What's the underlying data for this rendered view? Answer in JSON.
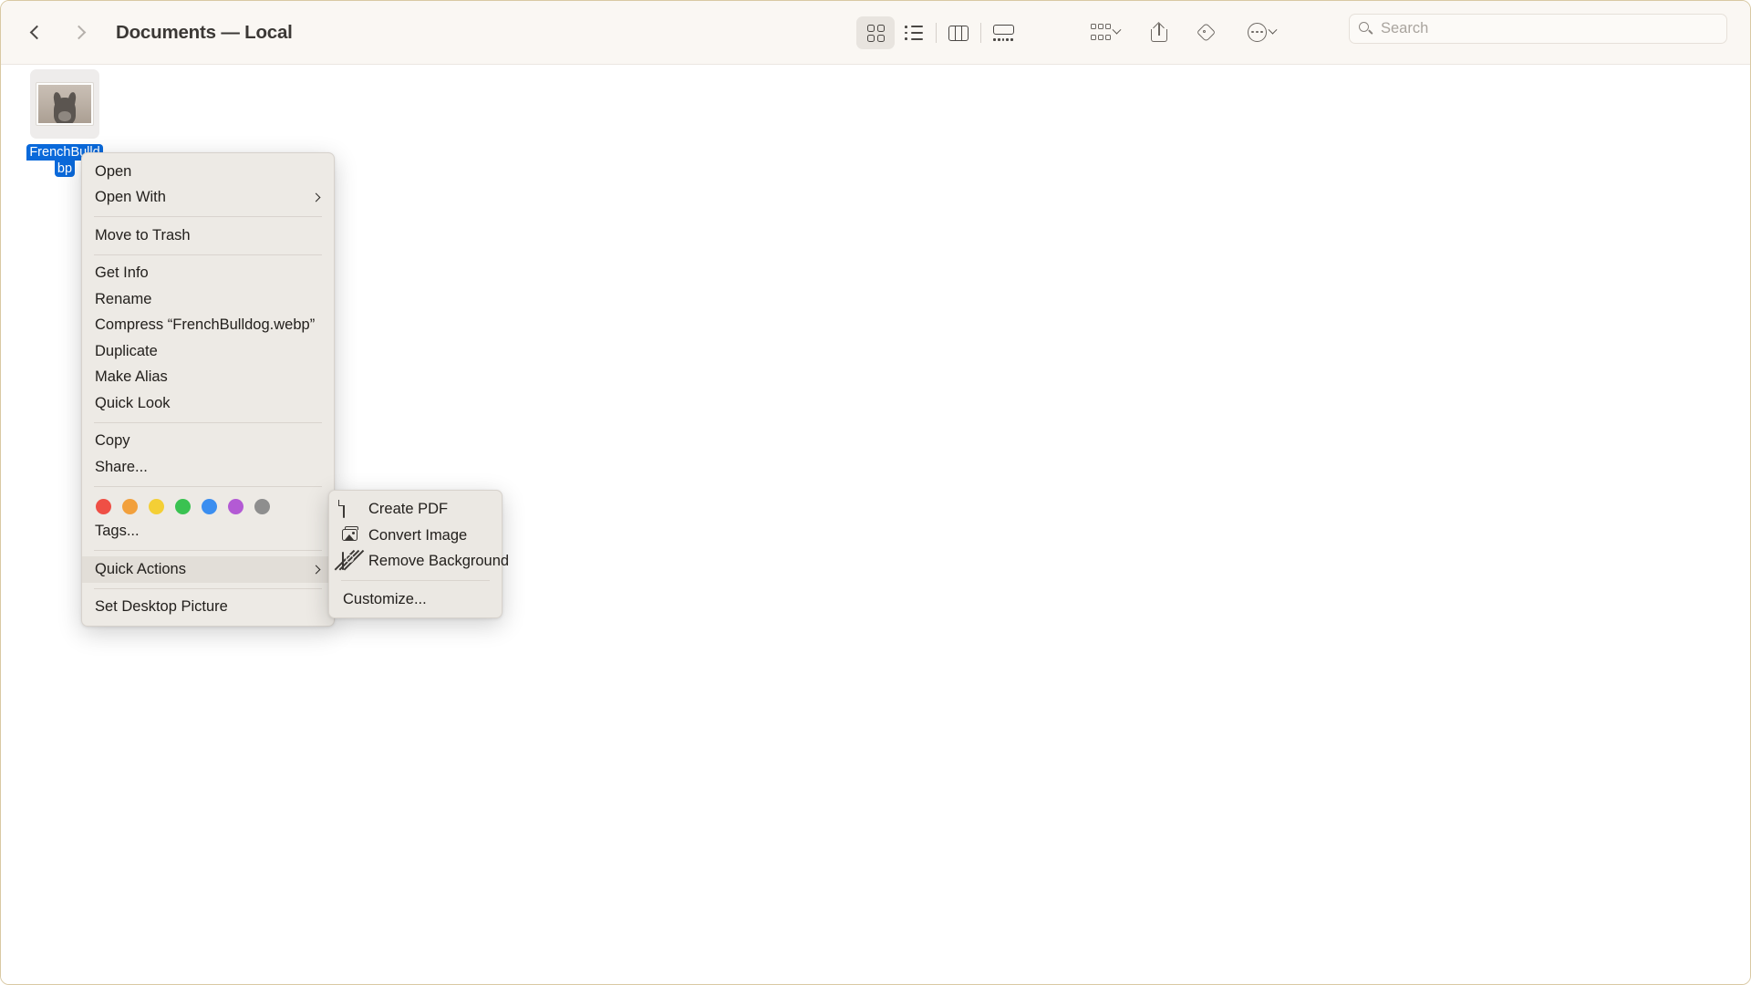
{
  "window": {
    "title": "Documents — Local"
  },
  "nav": {
    "back_label": "Back",
    "forward_label": "Forward"
  },
  "toolbar": {
    "view_modes": [
      {
        "name": "icon-view",
        "label": "Icon View",
        "active": true
      },
      {
        "name": "list-view",
        "label": "List View",
        "active": false
      },
      {
        "name": "column-view",
        "label": "Column View",
        "active": false
      },
      {
        "name": "gallery-view",
        "label": "Gallery View",
        "active": false
      }
    ],
    "actions": [
      {
        "name": "group-by",
        "label": "Group By"
      },
      {
        "name": "share",
        "label": "Share"
      },
      {
        "name": "tags",
        "label": "Tags"
      },
      {
        "name": "more",
        "label": "More"
      }
    ]
  },
  "search": {
    "placeholder": "Search",
    "value": ""
  },
  "file": {
    "name_line1": "FrenchBulld",
    "name_line2": "bp",
    "full_name": "FrenchBulldog.webp",
    "selected": true,
    "selection_color": "#0a69da"
  },
  "context_menu": {
    "groups": [
      [
        {
          "label": "Open",
          "name": "menu-open",
          "submenu": false
        },
        {
          "label": "Open With",
          "name": "menu-open-with",
          "submenu": true
        }
      ],
      [
        {
          "label": "Move to Trash",
          "name": "menu-move-to-trash",
          "submenu": false
        }
      ],
      [
        {
          "label": "Get Info",
          "name": "menu-get-info",
          "submenu": false
        },
        {
          "label": "Rename",
          "name": "menu-rename",
          "submenu": false
        },
        {
          "label": "Compress “FrenchBulldog.webp”",
          "name": "menu-compress",
          "submenu": false
        },
        {
          "label": "Duplicate",
          "name": "menu-duplicate",
          "submenu": false
        },
        {
          "label": "Make Alias",
          "name": "menu-make-alias",
          "submenu": false
        },
        {
          "label": "Quick Look",
          "name": "menu-quick-look",
          "submenu": false
        }
      ],
      [
        {
          "label": "Copy",
          "name": "menu-copy",
          "submenu": false
        },
        {
          "label": "Share...",
          "name": "menu-share",
          "submenu": false
        }
      ]
    ],
    "tags_row": {
      "label": "Tags...",
      "colors": [
        {
          "name": "tag-red",
          "hex": "#ef4f45"
        },
        {
          "name": "tag-orange",
          "hex": "#f2a03c"
        },
        {
          "name": "tag-yellow",
          "hex": "#f4cf35"
        },
        {
          "name": "tag-green",
          "hex": "#3ac251"
        },
        {
          "name": "tag-blue",
          "hex": "#3b8ef0"
        },
        {
          "name": "tag-purple",
          "hex": "#b35ad4"
        },
        {
          "name": "tag-gray",
          "hex": "#8e8e8e"
        }
      ]
    },
    "quick_actions": {
      "label": "Quick Actions",
      "highlighted": true
    },
    "set_desktop_picture": {
      "label": "Set Desktop Picture"
    }
  },
  "submenu": {
    "items": [
      {
        "label": "Create PDF",
        "name": "submenu-create-pdf",
        "icon": "document-icon"
      },
      {
        "label": "Convert Image",
        "name": "submenu-convert-image",
        "icon": "photo-stack-icon"
      },
      {
        "label": "Remove Background",
        "name": "submenu-remove-background",
        "icon": "remove-background-icon"
      }
    ],
    "customize": {
      "label": "Customize...",
      "name": "submenu-customize"
    }
  }
}
